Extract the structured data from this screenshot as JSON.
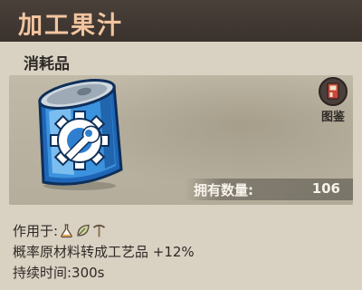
{
  "header": {
    "title": "加工果汁"
  },
  "item": {
    "category": "消耗品",
    "icon": "blue-can-with-gear-wrench-icon",
    "owned_label": "拥有数量:",
    "owned_count": "106"
  },
  "catalog": {
    "label": "图鉴",
    "icon": "catalog-book-icon"
  },
  "description": {
    "applies_to_label": "作用于:",
    "applies_to_icons": [
      "flask-icon",
      "leaf-icon",
      "pickaxe-icon"
    ],
    "effect": "概率原材料转成工艺品 +12%",
    "duration": "持续时间:300s"
  },
  "colors": {
    "header_bg": "#3f3631",
    "title_text": "#f2c59f",
    "body_bg": "#d9d1c2",
    "can_blue": "#3a8fd8"
  }
}
